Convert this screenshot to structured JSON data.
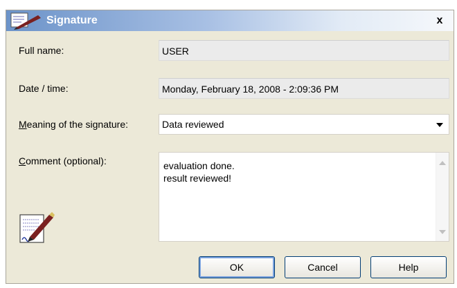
{
  "window": {
    "title": "Signature",
    "close_label": "x"
  },
  "fields": {
    "full_name": {
      "label": "Full name:",
      "value": "USER"
    },
    "date_time": {
      "label": "Date / time:",
      "value": "Monday, February 18, 2008  -  2:09:36 PM"
    },
    "meaning": {
      "label_mnemonic": "M",
      "label_rest": "eaning of the signature:",
      "value": "Data reviewed"
    },
    "comment": {
      "label_mnemonic": "C",
      "label_rest": "omment (optional):",
      "lines": [
        "evaluation done.",
        "result reviewed!"
      ]
    }
  },
  "buttons": {
    "ok": "OK",
    "cancel": "Cancel",
    "help": "Help"
  },
  "colors": {
    "titlebar_start": "#6c93c9",
    "dialog_bg": "#ece9d8",
    "button_border": "#003c74"
  }
}
